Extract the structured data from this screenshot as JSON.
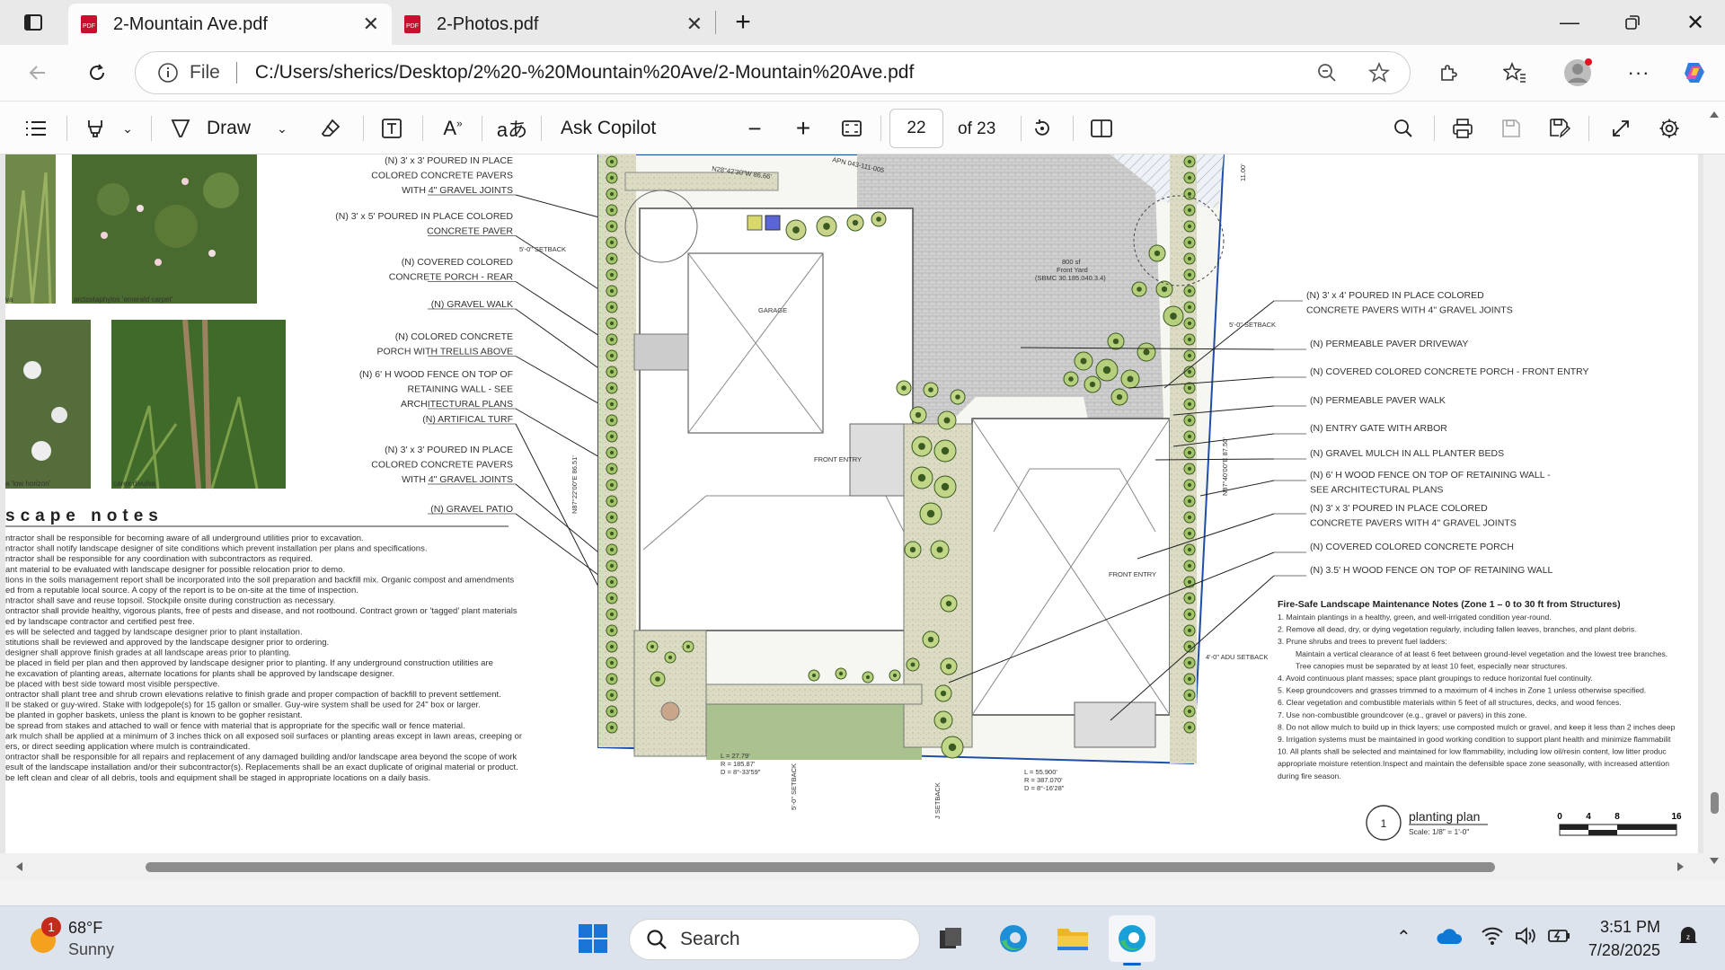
{
  "tabs": [
    {
      "title": "2-Mountain Ave.pdf",
      "active": true
    },
    {
      "title": "2-Photos.pdf",
      "active": false
    }
  ],
  "address": {
    "scheme_label": "File",
    "url": "C:/Users/sherics/Desktop/2%20-%20Mountain%20Ave/2-Mountain%20Ave.pdf"
  },
  "pdf_toolbar": {
    "draw_label": "Draw",
    "copilot_label": "Ask Copilot",
    "page_number": "22",
    "page_total": "of 23"
  },
  "document": {
    "photo_captions": [
      "arctostaphylos 'emerald carpet'",
      "a 'low horizon'",
      "carex divulsa",
      "va"
    ],
    "notes_heading": "scape notes",
    "notes": [
      "ntractor shall be responsible for becoming aware of all underground utilities prior to excavation.",
      "ntractor shall notify landscape designer of site conditions which prevent installation per plans and specifications.",
      "ntractor shall be responsible for any coordination with subcontractors as required.",
      "ant material to be evaluated with landscape designer for possible relocation prior to demo.",
      "tions in the soils management report shall be incorporated into the soil preparation and backfill mix. Organic compost and amendments",
      "ed from a reputable local source. A copy of the report is to be on-site at the time of inspection.",
      "ntractor shall save and reuse topsoil. Stockpile onsite during construction as necessary.",
      "ontractor shall provide healthy, vigorous plants, free of pests and disease, and not rootbound. Contract grown or 'tagged' plant materials",
      "ed by landscape contractor and certified pest free.",
      "es will be selected and tagged by landscape designer prior to plant installation.",
      "stitutions shall be reviewed and approved by the landscape designer prior to ordering.",
      "designer shall approve finish grades at all landscape areas prior to planting.",
      "be placed in field per plan and then approved by landscape designer prior to planting. If any underground construction utilities are",
      "he excavation of planting areas, alternate locations for plants shall be approved by landscape designer.",
      "be placed with best side toward most visible perspective.",
      "ontractor shall plant tree and shrub crown elevations relative to finish grade and proper compaction of backfill to prevent settlement.",
      "ll be staked or guy-wired. Stake with lodgepole(s) for 15 gallon or smaller. Guy-wire system shall be used for 24\" box or larger.",
      "be planted in gopher baskets, unless the plant is known to be gopher resistant.",
      "be spread from stakes and attached to wall or fence with material that is appropriate for the specific wall or fence material.",
      "ark mulch shall be applied at a minimum of 3 inches thick on all exposed soil surfaces or planting areas except in lawn areas, creeping or",
      "ers, or direct seeding application where mulch is contraindicated.",
      "ontractor shall be responsible for all repairs and replacement of any damaged building and/or landscape area beyond the scope of work",
      "esult of the landscape installation and/or their subcontractor(s). Replacements shall be an exact duplicate of original material or product.",
      "be left clean and clear of all debris, tools and equipment shall be staged in appropriate locations on a daily basis."
    ],
    "left_callouts": [
      [
        "(N) 3' x 3' POURED IN PLACE",
        "COLORED CONCRETE PAVERS",
        "WITH 4\" GRAVEL JOINTS"
      ],
      [
        "(N) 3' x 5' POURED IN PLACE COLORED",
        "CONCRETE PAVER"
      ],
      [
        "(N) COVERED COLORED",
        "CONCRETE PORCH - REAR"
      ],
      [
        "(N) GRAVEL WALK"
      ],
      [
        "(N) COLORED CONCRETE",
        "PORCH WITH TRELLIS ABOVE"
      ],
      [
        "(N) 6' H WOOD FENCE ON TOP OF",
        "RETAINING WALL - SEE",
        "ARCHITECTURAL PLANS"
      ],
      [
        "(N) ARTIFICAL TURF"
      ],
      [
        "(N) 3' x 3' POURED IN PLACE",
        "COLORED CONCRETE PAVERS",
        "WITH 4\" GRAVEL JOINTS"
      ],
      [
        "(N) GRAVEL PATIO"
      ]
    ],
    "right_callouts": [
      [
        "(N) 3' x 4' POURED IN PLACE  COLORED",
        "CONCRETE PAVERS WITH 4\" GRAVEL JOINTS"
      ],
      [
        "(N) PERMEABLE PAVER DRIVEWAY"
      ],
      [
        "(N) COVERED COLORED CONCRETE PORCH - FRONT ENTRY"
      ],
      [
        "(N) PERMEABLE PAVER WALK"
      ],
      [
        "(N) ENTRY GATE WITH ARBOR"
      ],
      [
        "(N) GRAVEL MULCH IN ALL PLANTER BEDS"
      ],
      [
        "(N) 6' H WOOD FENCE ON TOP OF RETAINING WALL -",
        "SEE ARCHITECTURAL PLANS"
      ],
      [
        "(N) 3' x 3' POURED IN PLACE COLORED",
        "CONCRETE PAVERS WITH 4\" GRAVEL JOINTS"
      ],
      [
        "(N) COVERED COLORED CONCRETE PORCH"
      ],
      [
        "(N) 3.5' H WOOD FENCE ON TOP OF RETAINING WALL"
      ]
    ],
    "plan_labels": {
      "garage": "GARAGE",
      "front_entry": "FRONT ENTRY",
      "front_entry_2": "FRONT ENTRY",
      "setback_5_left": "5'-0\" SETBACK",
      "setback_5_right": "5'-0\" SETBACK",
      "adu_setback": "4'-0\" ADU SETBACK",
      "setback_5_bottom": "5'-0\" SETBACK",
      "setback_j": "J SETBACK",
      "apn": "APN 043-111-005",
      "curve_left": [
        "L = 27.79'",
        "R = 185.87'",
        "D = 8°-33'59\""
      ],
      "curve_right": [
        "L = 55.900'",
        "R = 387.070'",
        "D = 8°-16'28\""
      ],
      "dim_11": "11.00'",
      "dim_left": "N87°22'00\"E 86.51'",
      "dim_right": "N87°40'00\"E 87.50'",
      "dim_top": "N28°42'30\"W 86.66'",
      "front_yard": [
        "800 sf",
        "Front Yard",
        "(SBMC 30.185.040.3.4)"
      ]
    },
    "fire_notes_title": "Fire-Safe Landscape Maintenance Notes (Zone 1 – 0 to 30 ft from Structures)",
    "fire_notes": [
      "1. Maintain plantings in a healthy, green, and well-irrigated condition year-round.",
      "2. Remove all dead, dry, or dying vegetation regularly, including fallen leaves, branches, and plant debris.",
      "3. Prune shrubs and trees to prevent fuel ladders:",
      "    Maintain a vertical clearance of at least 6 feet between ground-level vegetation and the lowest tree branches.",
      "    Tree canopies must be separated by at least 10 feet, especially near structures.",
      "4. Avoid continuous plant masses; space plant groupings to reduce horizontal fuel continuity.",
      "5. Keep groundcovers and grasses trimmed to a maximum of 4 inches in Zone 1 unless otherwise specified.",
      "6. Clear vegetation and combustible materials within 5 feet of all structures, decks, and wood fences.",
      "7. Use non-combustible groundcover (e.g., gravel or pavers) in this zone.",
      "8. Do not allow mulch to build up in thick layers; use composted mulch or gravel, and keep it less than 2 inches deep",
      "9. Irrigation systems must be maintained in good working condition to support plant health and minimize flammabilit",
      "10. All plants shall be selected and maintained for low flammability, including low oil/resin content, low litter produc",
      "appropriate moisture retention.Inspect and maintain the defensible space zone seasonally, with increased attention",
      "during fire season."
    ],
    "title_block": {
      "number": "1",
      "title": "planting plan",
      "scale": "Scale: 1/8\" = 1'-0\""
    },
    "scale_ticks": [
      "0",
      "4",
      "8",
      "16"
    ]
  },
  "taskbar": {
    "weather_temp": "68°F",
    "weather_desc": "Sunny",
    "weather_badge": "1",
    "search_label": "Search",
    "time": "3:51 PM",
    "date": "7/28/2025"
  }
}
